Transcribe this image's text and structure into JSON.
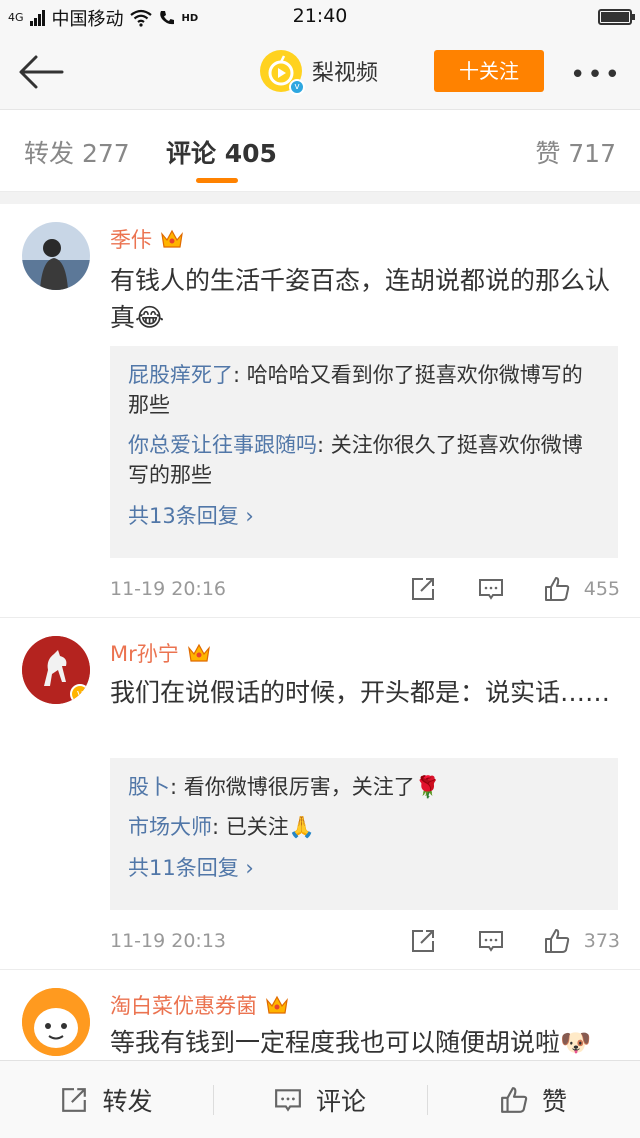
{
  "status_bar": {
    "network": "4G",
    "carrier": "中国移动",
    "hd": "HD",
    "time": "21:40"
  },
  "nav": {
    "title": "梨视频",
    "follow_label": "十关注",
    "more_label": "•••"
  },
  "tabs": {
    "repost": "转发 277",
    "comment": "评论 405",
    "like": "赞 717"
  },
  "comments": [
    {
      "name": "季佧",
      "text": "有钱人的生活千姿百态，连胡说都说的那么认真",
      "emoji": "😂",
      "replies": [
        {
          "name": "屁股痒死了",
          "text": ": 哈哈哈又看到你了挺喜欢你微博写的那些"
        },
        {
          "name": "你总爱让往事跟随吗",
          "text": ": 关注你很久了挺喜欢你微博写的那些"
        }
      ],
      "more_replies": "共13条回复 ›",
      "time": "11-19 20:16",
      "likes": "455"
    },
    {
      "name": "Mr孙宁",
      "text": "我们在说假话的时候，开头都是：说实话……",
      "emoji": "",
      "replies": [
        {
          "name": "股卜",
          "text": ": 看你微博很厉害，关注了🌹"
        },
        {
          "name": "市场大师",
          "text": ": 已关注🙏"
        }
      ],
      "more_replies": "共11条回复 ›",
      "time": "11-19 20:13",
      "likes": "373"
    },
    {
      "name": "淘白菜优惠券菌",
      "text": "等我有钱到一定程度我也可以随便胡说啦",
      "emoji": "🐶"
    }
  ],
  "bottom_bar": {
    "repost": "转发",
    "comment": "评论",
    "like": "赞"
  },
  "colors": {
    "accent": "#ff8200",
    "name": "#eb7350",
    "link": "#5177a8"
  }
}
